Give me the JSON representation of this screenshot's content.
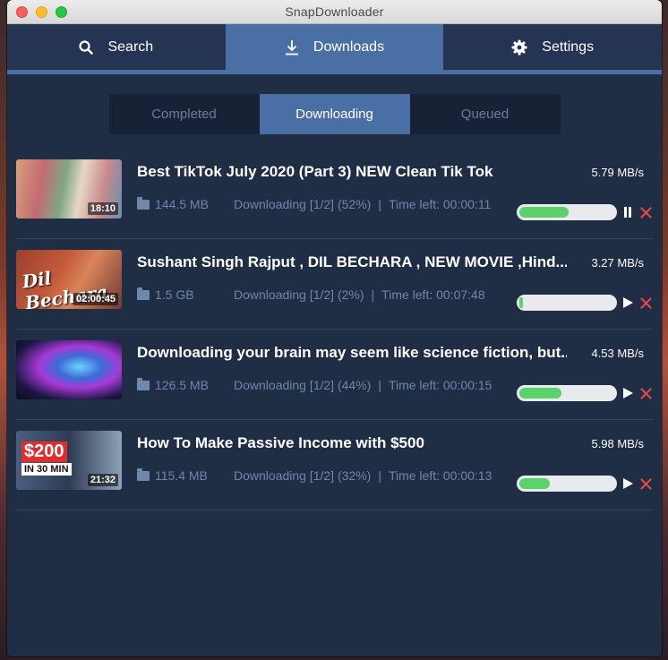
{
  "window": {
    "title": "SnapDownloader"
  },
  "nav": {
    "tabs": [
      {
        "label": "Search",
        "icon": "search-icon",
        "active": false
      },
      {
        "label": "Downloads",
        "icon": "download-icon",
        "active": true
      },
      {
        "label": "Settings",
        "icon": "gear-icon",
        "active": false
      }
    ]
  },
  "segments": [
    {
      "label": "Completed",
      "active": false
    },
    {
      "label": "Downloading",
      "active": true
    },
    {
      "label": "Queued",
      "active": false
    }
  ],
  "downloads": [
    {
      "title": "Best TikTok July 2020 (Part 3) NEW Clean Tik Tok",
      "speed": "5.79 MB/s",
      "size": "144.5 MB",
      "status": "Downloading [1/2] (52%)",
      "separator": "|",
      "time_left": "Time left: 00:00:11",
      "duration": "18:10",
      "progress": 0.52,
      "control": "pause-icon"
    },
    {
      "title": "Sushant Singh Rajput , DIL BECHARA , NEW MOVIE ,Hind...",
      "speed": "3.27 MB/s",
      "size": "1.5 GB",
      "status": "Downloading [1/2] (2%)",
      "separator": "|",
      "time_left": "Time left: 00:07:48",
      "duration": "02:00:45",
      "thumb_caption": "Dil Bechara",
      "progress": 0.02,
      "control": "play-icon"
    },
    {
      "title": "Downloading your brain may seem like science fiction, but...",
      "speed": "4.53 MB/s",
      "size": "126.5 MB",
      "status": "Downloading [1/2] (44%)",
      "separator": "|",
      "time_left": "Time left: 00:00:15",
      "duration": "",
      "progress": 0.44,
      "control": "play-icon"
    },
    {
      "title": "How To Make Passive Income with $500",
      "speed": "5.98 MB/s",
      "size": "115.4 MB",
      "status": "Downloading [1/2] (32%)",
      "separator": "|",
      "time_left": "Time left: 00:00:13",
      "duration": "21:32",
      "thumb_badge": "$200",
      "thumb_badge2": "IN 30 MIN",
      "progress": 0.32,
      "control": "play-icon"
    }
  ],
  "colors": {
    "accent": "#4a6fa5",
    "background": "#1f2d45",
    "progress": "#5cd26c",
    "cancel": "#e04848",
    "meta_text": "#6f87ab"
  }
}
